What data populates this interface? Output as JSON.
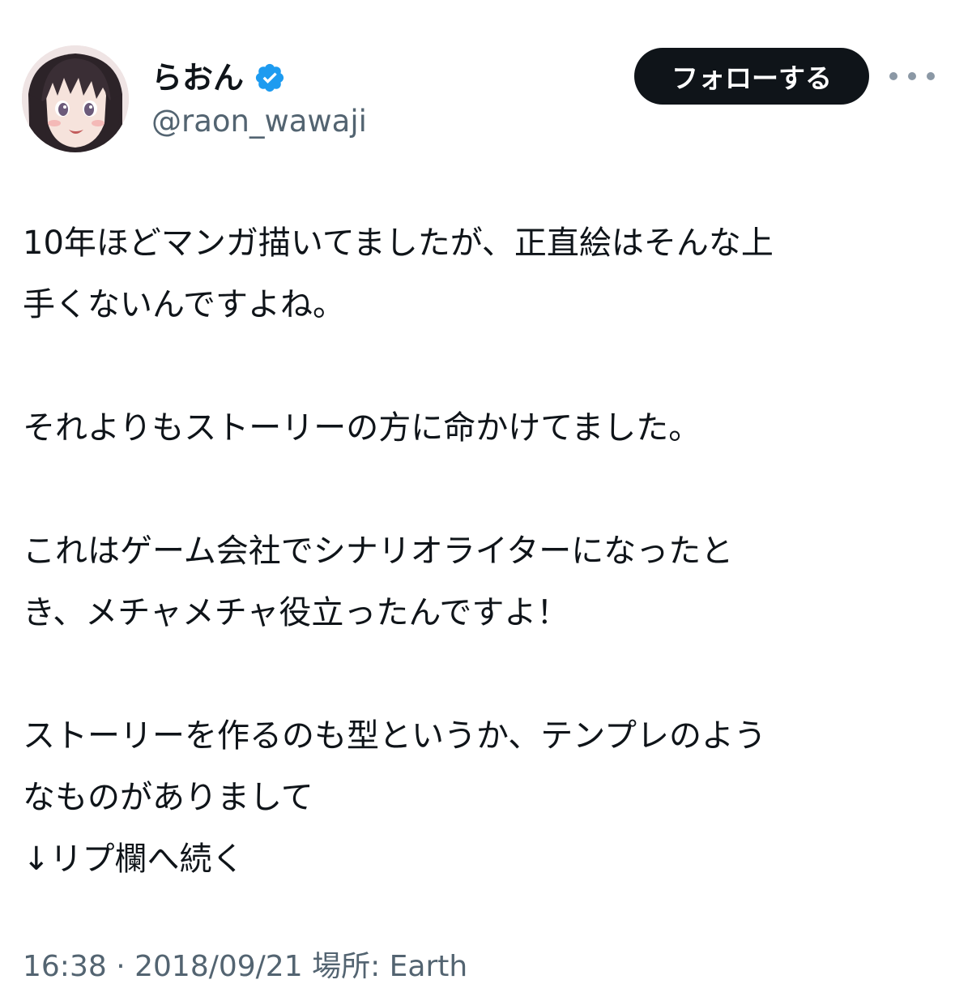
{
  "author": {
    "display_name": "らおん",
    "handle": "@raon_wawaji",
    "verified": true,
    "verified_color": "#1d9bf0"
  },
  "actions": {
    "follow_label": "フォローする",
    "more_icon": "more-horizontal-icon"
  },
  "tweet": {
    "text": "10年ほどマンガ描いてましたが、正直絵はそんな上\n手くないんですよね。\n\nそれよりもストーリーの方に命かけてました。\n\nこれはゲーム会社でシナリオライターになったと\nき、メチャメチャ役立ったんですよ！\n\nストーリーを作るのも型というか、テンプレのよう\nなものがありまして\n↓リプ欄へ続く",
    "time": "16:38",
    "separator": "·",
    "date": "2018/09/21",
    "location_label": "場所:",
    "location": "Earth"
  }
}
